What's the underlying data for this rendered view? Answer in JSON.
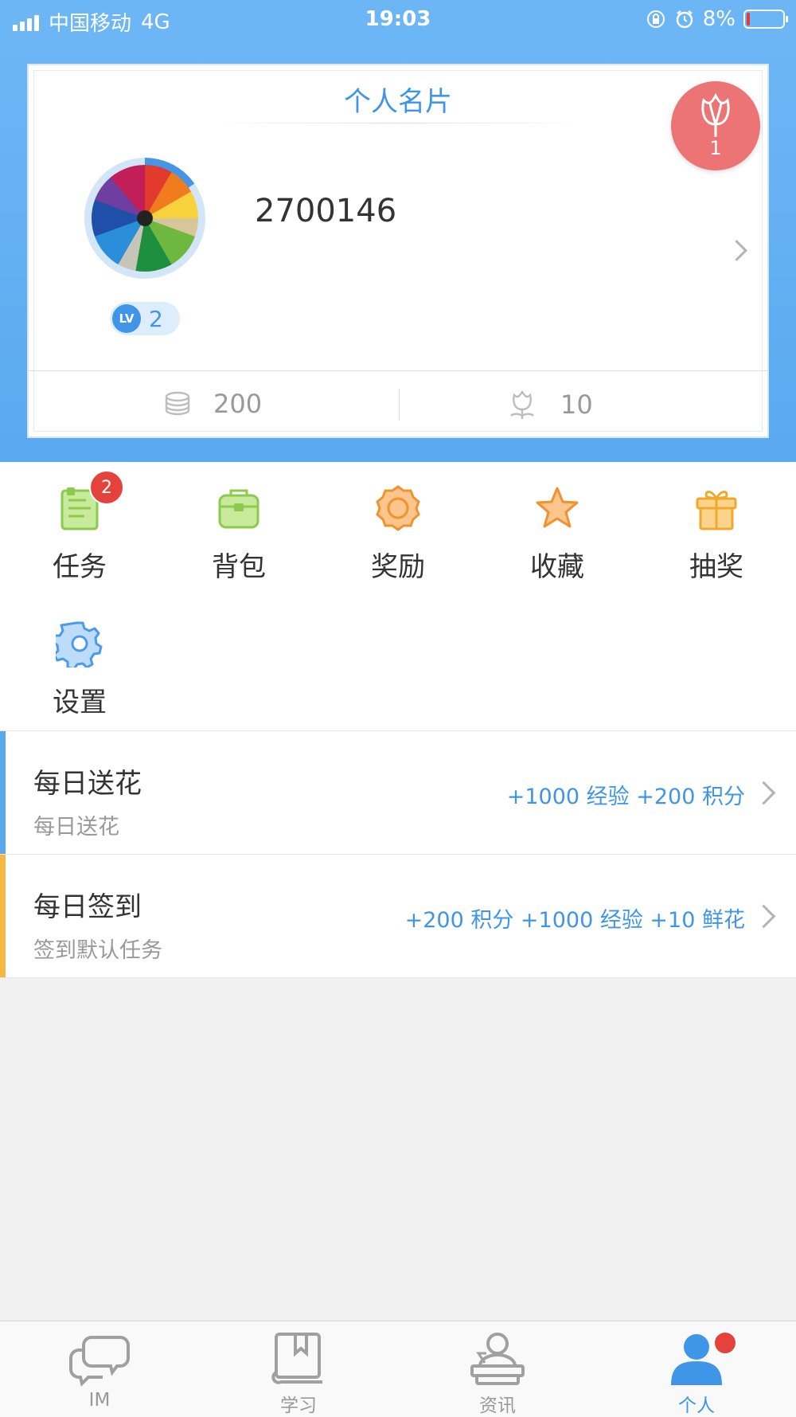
{
  "status_bar": {
    "carrier": "中国移动",
    "network": "4G",
    "time": "19:03",
    "battery": "8%"
  },
  "card": {
    "title": "个人名片",
    "flower_count": "1",
    "username": "2700146",
    "level_prefix": "LV",
    "level": "2",
    "coins": "200",
    "flowers": "10"
  },
  "menu": {
    "badge_count": "2",
    "items": [
      {
        "label": "任务",
        "icon": "task-icon"
      },
      {
        "label": "背包",
        "icon": "backpack-icon"
      },
      {
        "label": "奖励",
        "icon": "award-icon"
      },
      {
        "label": "收藏",
        "icon": "star-icon"
      },
      {
        "label": "抽奖",
        "icon": "gift-icon"
      },
      {
        "label": "设置",
        "icon": "gear-icon"
      }
    ]
  },
  "tasks": [
    {
      "title": "每日送花",
      "subtitle": "每日送花",
      "reward": "+1000 经验 +200 积分",
      "color": "#5aa9ef"
    },
    {
      "title": "每日签到",
      "subtitle": "签到默认任务",
      "reward": "+200 积分 +1000 经验 +10 鲜花",
      "color": "#f5b942"
    }
  ],
  "tabs": [
    {
      "label": "IM",
      "icon": "chat-icon"
    },
    {
      "label": "学习",
      "icon": "book-icon"
    },
    {
      "label": "资讯",
      "icon": "news-icon"
    },
    {
      "label": "个人",
      "icon": "person-icon",
      "active": true
    }
  ],
  "colors": {
    "accent": "#3f95e7",
    "header": "#6cb6f5",
    "badge": "#e5423b"
  }
}
